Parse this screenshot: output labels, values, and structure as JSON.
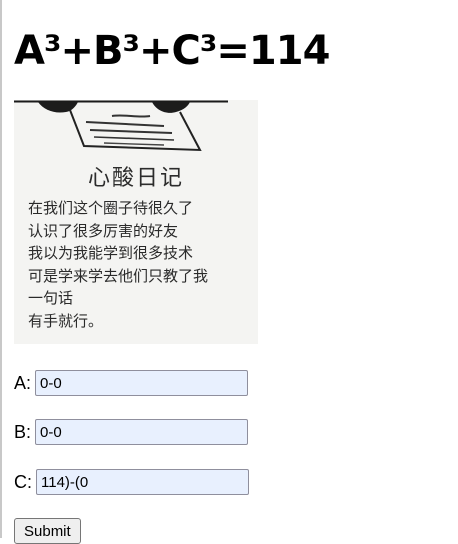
{
  "page": {
    "title": "A³+B³+C³=114"
  },
  "meme": {
    "heading": "心酸日记",
    "lines": [
      "在我们这个圈子待很久了",
      "认识了很多厉害的好友",
      "我以为我能学到很多技术",
      "可是学来学去他们只教了我",
      "一句话",
      "有手就行。"
    ]
  },
  "form": {
    "a": {
      "label": "A:",
      "value": "0-0"
    },
    "b": {
      "label": "B:",
      "value": "0-0"
    },
    "c": {
      "label": "C:",
      "value": "114)-(0"
    },
    "submit_label": "Submit"
  }
}
